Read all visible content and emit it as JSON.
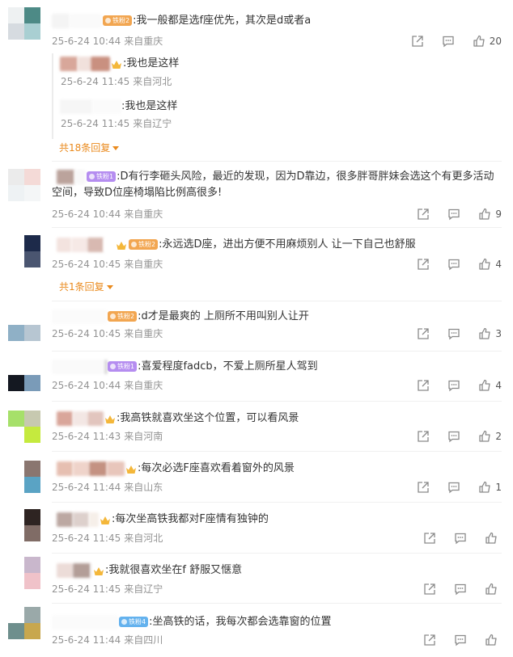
{
  "comments": [
    {
      "badge": "铁粉2",
      "text": ":我一般都是选f座优先，其次是d或者a",
      "time": "25-6-24 10:44",
      "location": "来自重庆",
      "likes": "20",
      "replies": [
        {
          "text": ":我也是这样",
          "time": "25-6-24 11:45",
          "location": "来自河北"
        },
        {
          "text": ":我也是这样",
          "time": "25-6-24 11:45",
          "location": "来自辽宁"
        }
      ],
      "more_replies": "共18条回复"
    },
    {
      "badge": "铁粉1",
      "text": ":D有行李砸头风险，最近的发现，因为D靠边，很多胖哥胖妹会选这个有更多活动空间，导致D位座椅塌陷比例高很多!",
      "time": "25-6-24 10:44",
      "location": "来自重庆",
      "likes": "9"
    },
    {
      "badge": "铁粉2",
      "text": ":永远选D座，进出方便不用麻烦别人 让一下自己也舒服",
      "time": "25-6-24 10:45",
      "location": "来自重庆",
      "likes": "4",
      "more_replies": "共1条回复"
    },
    {
      "badge": "铁粉2",
      "text": ":d才是最爽的 上厕所不用叫别人让开",
      "time": "25-6-24 10:45",
      "location": "来自重庆",
      "likes": "3"
    },
    {
      "badge": "铁粉1",
      "text": ":喜爱程度fadcb，不爱上厕所星人驾到",
      "time": "25-6-24 10:44",
      "location": "来自重庆",
      "likes": "4"
    },
    {
      "text": ":我高铁就喜欢坐这个位置，可以看风景",
      "time": "25-6-24 11:43",
      "location": "来自河南",
      "likes": "2"
    },
    {
      "text": ":每次必选F座喜欢看着窗外的风景",
      "time": "25-6-24 11:44",
      "location": "来自山东",
      "likes": "1"
    },
    {
      "text": ":每次坐高铁我都对F座情有独钟的",
      "time": "25-6-24 11:45",
      "location": "来自河北",
      "likes": ""
    },
    {
      "text": ":我就很喜欢坐在f 舒服又惬意",
      "time": "25-6-24 11:45",
      "location": "来自辽宁",
      "likes": ""
    },
    {
      "badge": "铁粉4",
      "text": ":坐高铁的话，我每次都会选靠窗的位置",
      "time": "25-6-24 11:44",
      "location": "来自四川",
      "likes": ""
    }
  ],
  "icons": {
    "share": "share-icon",
    "comment": "comment-icon",
    "like": "thumbs-up-icon",
    "crown": "crown-icon"
  },
  "colors": {
    "accent": "#ea8a1d",
    "meta": "#939393",
    "badge_orange": "#f2a651",
    "badge_purple": "#b58df0",
    "badge_blue": "#64b2ee"
  }
}
